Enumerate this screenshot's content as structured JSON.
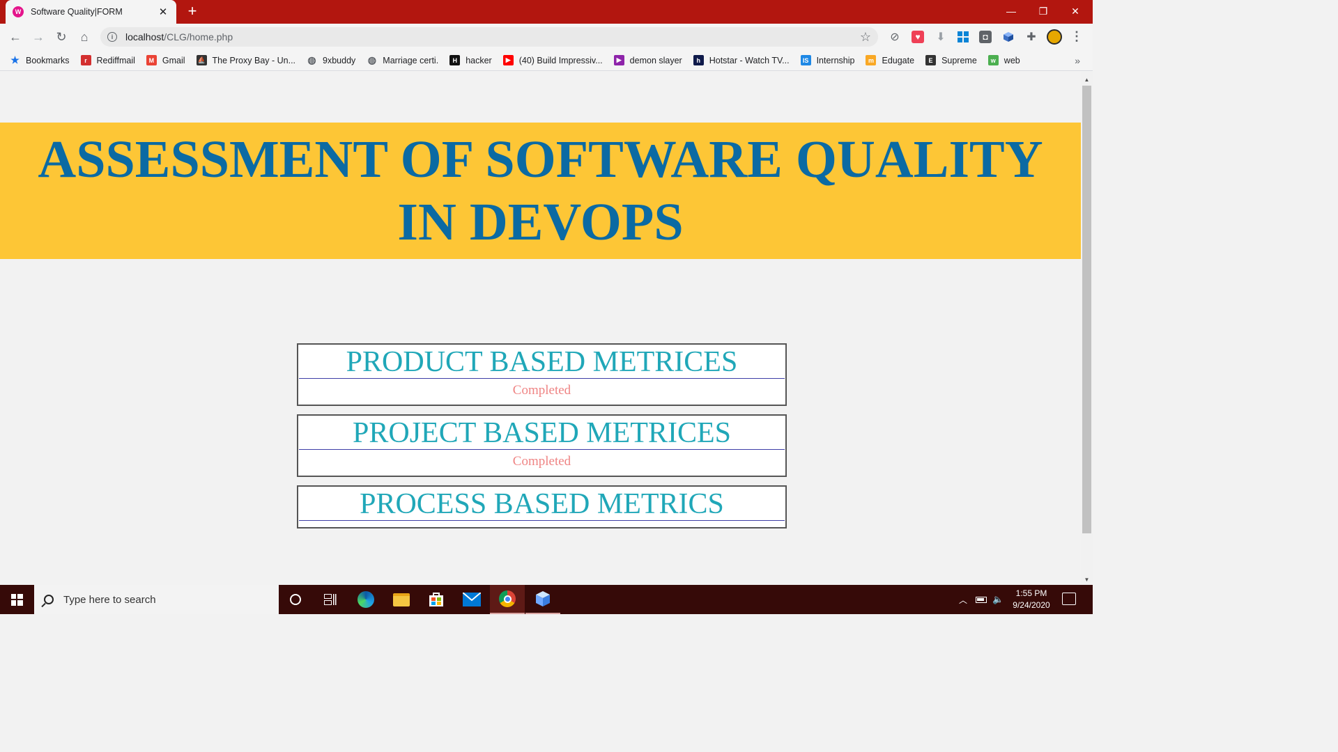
{
  "browser": {
    "tab_title": "Software Quality|FORM",
    "tab_favicon_letter": "W",
    "new_tab": "+",
    "url_host": "localhost",
    "url_path": "/CLG/home.php",
    "window_controls": {
      "minimize": "—",
      "restore": "❐",
      "close": "✕"
    },
    "icons": [
      "back-arrow-icon",
      "forward-arrow-icon",
      "reload-icon",
      "home-icon",
      "info-icon",
      "star-icon",
      "block-icon",
      "pocket-icon",
      "download-icon",
      "windows-icon",
      "camera-icon",
      "cube-icon",
      "puzzle-icon",
      "profile-avatar",
      "menu-icon"
    ]
  },
  "bookmarks": [
    {
      "label": "Bookmarks",
      "color": "#1a73e8",
      "glyph": "★"
    },
    {
      "label": "Rediffmail",
      "color": "#d32f2f",
      "glyph": "r"
    },
    {
      "label": "Gmail",
      "color": "#ea4335",
      "glyph": "M"
    },
    {
      "label": "The Proxy Bay - Un...",
      "color": "#333333",
      "glyph": "⛵"
    },
    {
      "label": "9xbuddy",
      "color": "#5f6368",
      "glyph": "◍"
    },
    {
      "label": "Marriage certi.",
      "color": "#5f6368",
      "glyph": "◍"
    },
    {
      "label": "hacker",
      "color": "#111111",
      "glyph": "H"
    },
    {
      "label": "(40) Build Impressiv...",
      "color": "#ff0000",
      "glyph": "▶"
    },
    {
      "label": "demon slayer",
      "color": "#8e24aa",
      "glyph": "▶"
    },
    {
      "label": "Hotstar - Watch TV...",
      "color": "#0f1a4a",
      "glyph": "h"
    },
    {
      "label": "Internship",
      "color": "#1e88e5",
      "glyph": "IS"
    },
    {
      "label": "Edugate",
      "color": "#f9a825",
      "glyph": "m"
    },
    {
      "label": "Supreme",
      "color": "#333333",
      "glyph": "E"
    },
    {
      "label": "web",
      "color": "#4caf50",
      "glyph": "w"
    }
  ],
  "bookmarks_more": "»",
  "page": {
    "heading": "ASSESSMENT OF SOFTWARE QUALITY IN DEVOPS",
    "cards": [
      {
        "title": "PRODUCT BASED METRICES",
        "status": "Completed"
      },
      {
        "title": "PROJECT BASED METRICES",
        "status": "Completed"
      },
      {
        "title": "PROCESS BASED METRICS",
        "status": ""
      }
    ]
  },
  "taskbar": {
    "search_placeholder": "Type here to search",
    "time": "1:55 PM",
    "date": "9/24/2020",
    "apps": [
      "cortana-icon",
      "task-view-icon",
      "edge-icon",
      "file-explorer-icon",
      "store-icon",
      "mail-icon",
      "chrome-icon",
      "app-cube-icon"
    ]
  },
  "colors": {
    "titlebar": "#b2160f",
    "banner_bg": "#fdc636",
    "heading": "#0b6aa3",
    "card_title": "#20a7b8",
    "status": "#ef8484",
    "taskbar": "#360a08"
  }
}
